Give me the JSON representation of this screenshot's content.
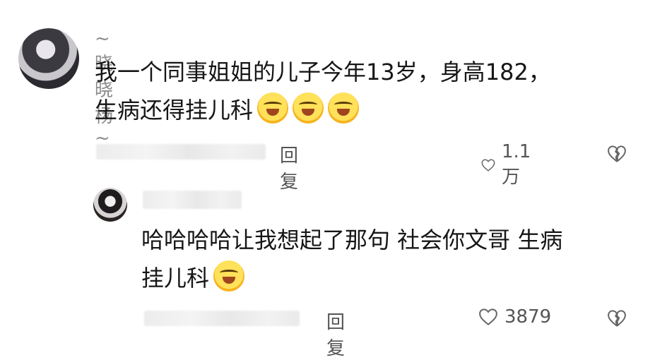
{
  "comment": {
    "username": "~晓晓杨~",
    "text_line1": "我一个同事姐姐的儿子今年13岁，身高182，",
    "text_line2": "生病还得挂儿科",
    "reply_label": "回复",
    "like_count": "1.1万"
  },
  "reply": {
    "text_line1": "哈哈哈哈让我想起了那句 社会你文哥 生病",
    "text_line2": "挂儿科",
    "reply_label": "回复",
    "like_count": "3879"
  },
  "icons": {
    "emoji": "laughing-crying-emoji",
    "like": "heart-outline-icon",
    "dislike": "broken-heart-icon"
  }
}
